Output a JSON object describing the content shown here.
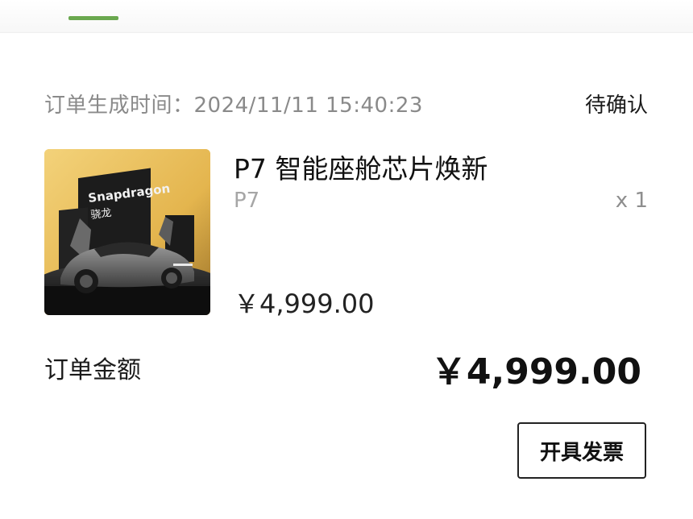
{
  "order": {
    "time_label": "订单生成时间：",
    "time_value": "2024/11/11 15:40:23",
    "status": "待确认"
  },
  "product": {
    "title": "P7 智能座舱芯片焕新",
    "variant": "P7",
    "quantity": "x 1",
    "price": "￥4,999.00",
    "image": {
      "brand_text": "Snapdragon",
      "brand_cn": "骁龙"
    }
  },
  "summary": {
    "total_label": "订单金额",
    "total_amount": "￥4,999.00"
  },
  "actions": {
    "invoice_label": "开具发票"
  },
  "colors": {
    "tab_indicator": "#6aa84f",
    "image_background": "#e7b84f"
  }
}
